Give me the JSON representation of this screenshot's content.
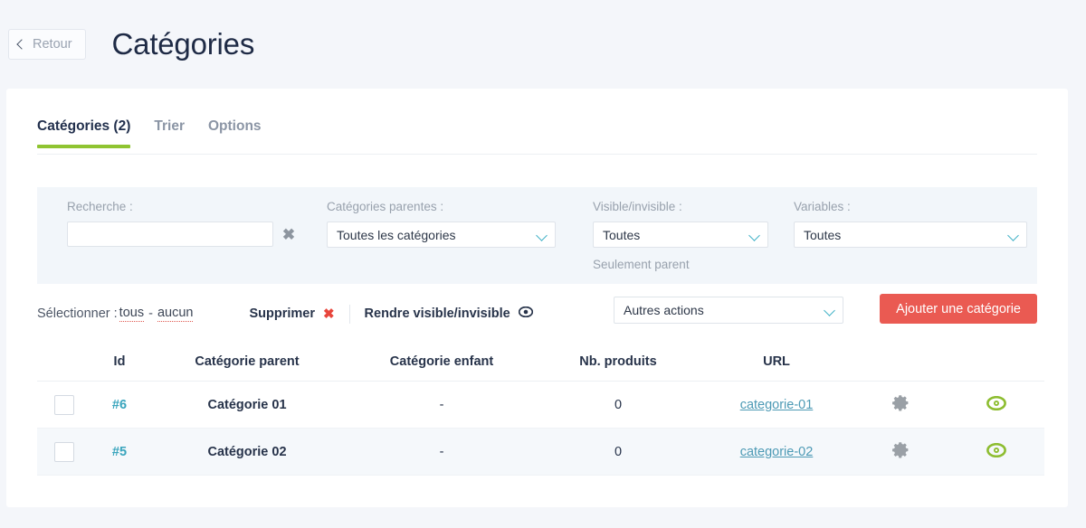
{
  "header": {
    "back_label": "Retour",
    "back_icon": "chevron-left-icon",
    "title": "Catégories"
  },
  "tabs": [
    {
      "label": "Catégories (2)",
      "active": true
    },
    {
      "label": "Trier",
      "active": false
    },
    {
      "label": "Options",
      "active": false
    }
  ],
  "filters": {
    "search": {
      "label": "Recherche :",
      "value": "",
      "placeholder": "",
      "clear_icon": "close-icon"
    },
    "parent": {
      "label": "Catégories parentes :",
      "selected": "Toutes les catégories",
      "options": [
        "Toutes les catégories"
      ]
    },
    "visibility": {
      "label": "Visible/invisible :",
      "selected": "Toutes",
      "options": [
        "Toutes"
      ],
      "note": "Seulement parent"
    },
    "variables": {
      "label": "Variables :",
      "selected": "Toutes",
      "options": [
        "Toutes"
      ]
    }
  },
  "actionbar": {
    "select_label": "Sélectionner :",
    "select_all": "tous",
    "separator": "-",
    "select_none": "aucun",
    "delete_label": "Supprimer",
    "delete_icon": "close-icon",
    "toggle_visibility_label": "Rendre visible/invisible",
    "toggle_visibility_icon": "eye-icon",
    "other_actions": {
      "selected": "Autres actions",
      "options": [
        "Autres actions"
      ]
    },
    "add_button": "Ajouter une catégorie"
  },
  "table": {
    "columns": [
      "",
      "Id",
      "Catégorie parent",
      "Catégorie enfant",
      "Nb. produits",
      "URL",
      "",
      ""
    ],
    "rows": [
      {
        "id": "#6",
        "parent": "Catégorie 01",
        "child": "-",
        "products": "0",
        "url": "categorie-01",
        "settings_icon": "gear-icon",
        "visibility_icon": "eye-icon"
      },
      {
        "id": "#5",
        "parent": "Catégorie 02",
        "child": "-",
        "products": "0",
        "url": "categorie-02",
        "settings_icon": "gear-icon",
        "visibility_icon": "eye-icon"
      }
    ]
  },
  "colors": {
    "page_background": "#f4f6fa",
    "card_background": "#ffffff",
    "accent_green": "#8fc431",
    "accent_red": "#ea5a52",
    "link_blue": "#4d9ab5",
    "id_teal": "#3aa5bd",
    "caret_teal": "#44b2c8",
    "filter_panel": "#f2f6fa",
    "row_alt": "#f5f8fb",
    "gear_gray": "#9aa0a6",
    "title_dark": "#1e2a45"
  }
}
